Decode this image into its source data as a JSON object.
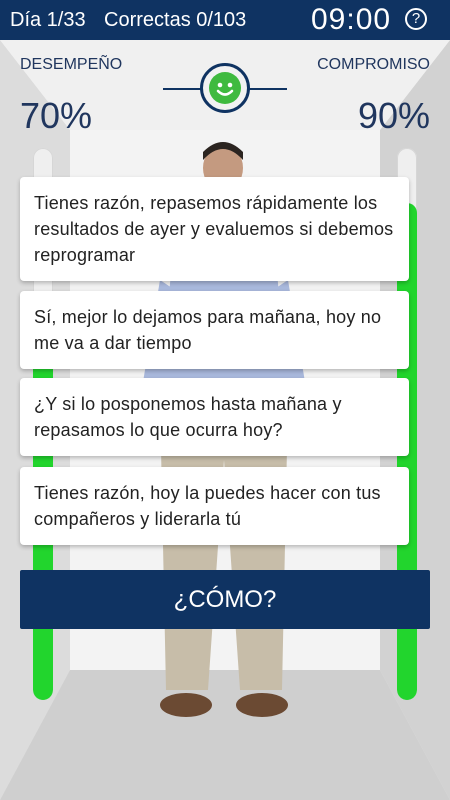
{
  "topbar": {
    "day": "Día 1/33",
    "correct": "Correctas 0/103",
    "timer": "09:00",
    "help_symbol": "?"
  },
  "stats": {
    "left_label": "DESEMPEÑO",
    "left_value": "70%",
    "right_label": "COMPROMISO",
    "right_value": "90%",
    "left_level": 0.7,
    "right_level": 0.9
  },
  "mood": {
    "icon": "smiley-face-icon",
    "color": "#3fba3f"
  },
  "answers": [
    {
      "text": "Tienes razón, repasemos rápidamente los resultados de ayer y evaluemos si debemos reprogramar"
    },
    {
      "text": "Sí, mejor lo dejamos para mañana, hoy no me va a dar tiempo"
    },
    {
      "text": "¿Y si lo posponemos hasta mañana y repasamos lo que ocurra hoy?"
    },
    {
      "text": "Tienes razón, hoy la puedes hacer con tus compañeros y liderarla tú"
    }
  ],
  "action": {
    "label": "¿CÓMO?"
  },
  "colors": {
    "brand": "#0f3362",
    "progress": "#22d52d"
  }
}
